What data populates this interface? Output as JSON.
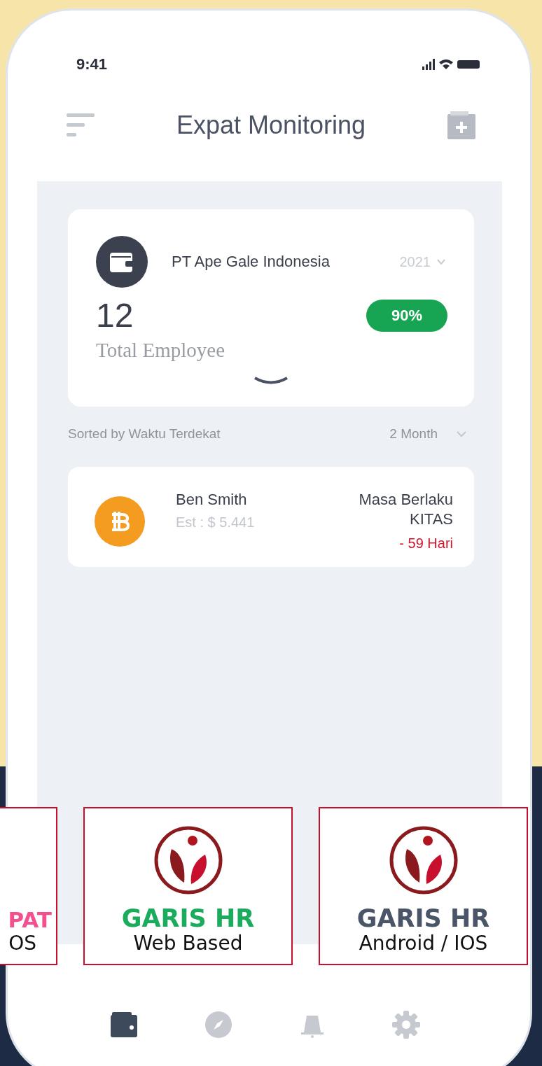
{
  "status_bar": {
    "time": "9:41"
  },
  "header": {
    "title": "Expat Monitoring"
  },
  "company_card": {
    "name": "PT Ape Gale Indonesia",
    "year": "2021",
    "count": "12",
    "count_label": "Total Employee",
    "badge": "90%"
  },
  "sort_bar": {
    "label": "Sorted by Waktu Terdekat",
    "period": "2 Month"
  },
  "employees": [
    {
      "name": "Ben Smith",
      "estimate": "Est : $ 5.441",
      "validity_label": "Masa Berlaku",
      "document": "KITAS",
      "remaining": "- 59 Hari"
    }
  ],
  "bottom_nav": [
    {
      "selected": true
    },
    {
      "selected": false
    },
    {
      "selected": false
    },
    {
      "selected": false
    }
  ],
  "promo_cards": [
    {
      "title": "PAT",
      "subtitle": "OS",
      "color": "#f2508f"
    },
    {
      "title": "GARIS HR",
      "subtitle": "Web Based",
      "color": "#1aac5c"
    },
    {
      "title": "GARIS HR",
      "subtitle": "Android / IOS",
      "color": "#4a5568"
    }
  ]
}
